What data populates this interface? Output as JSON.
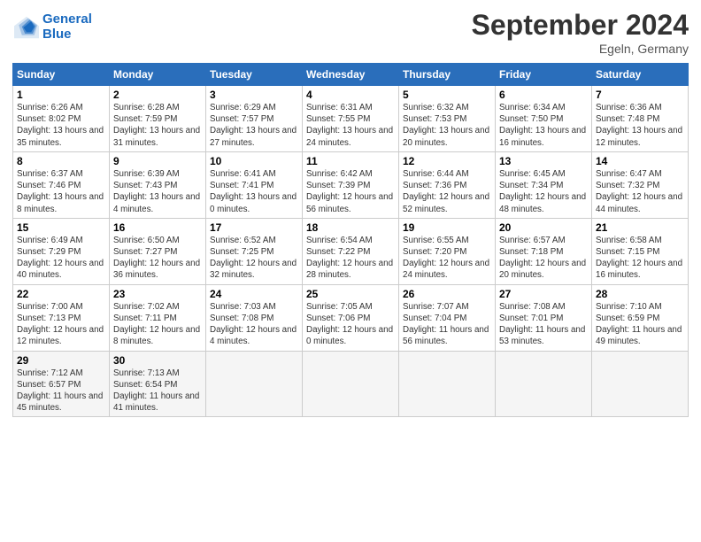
{
  "header": {
    "logo_line1": "General",
    "logo_line2": "Blue",
    "month_title": "September 2024",
    "location": "Egeln, Germany"
  },
  "days_of_week": [
    "Sunday",
    "Monday",
    "Tuesday",
    "Wednesday",
    "Thursday",
    "Friday",
    "Saturday"
  ],
  "weeks": [
    [
      {
        "day": "1",
        "sunrise": "6:26 AM",
        "sunset": "8:02 PM",
        "daylight": "13 hours and 35 minutes."
      },
      {
        "day": "2",
        "sunrise": "6:28 AM",
        "sunset": "7:59 PM",
        "daylight": "13 hours and 31 minutes."
      },
      {
        "day": "3",
        "sunrise": "6:29 AM",
        "sunset": "7:57 PM",
        "daylight": "13 hours and 27 minutes."
      },
      {
        "day": "4",
        "sunrise": "6:31 AM",
        "sunset": "7:55 PM",
        "daylight": "13 hours and 24 minutes."
      },
      {
        "day": "5",
        "sunrise": "6:32 AM",
        "sunset": "7:53 PM",
        "daylight": "13 hours and 20 minutes."
      },
      {
        "day": "6",
        "sunrise": "6:34 AM",
        "sunset": "7:50 PM",
        "daylight": "13 hours and 16 minutes."
      },
      {
        "day": "7",
        "sunrise": "6:36 AM",
        "sunset": "7:48 PM",
        "daylight": "13 hours and 12 minutes."
      }
    ],
    [
      {
        "day": "8",
        "sunrise": "6:37 AM",
        "sunset": "7:46 PM",
        "daylight": "13 hours and 8 minutes."
      },
      {
        "day": "9",
        "sunrise": "6:39 AM",
        "sunset": "7:43 PM",
        "daylight": "13 hours and 4 minutes."
      },
      {
        "day": "10",
        "sunrise": "6:41 AM",
        "sunset": "7:41 PM",
        "daylight": "13 hours and 0 minutes."
      },
      {
        "day": "11",
        "sunrise": "6:42 AM",
        "sunset": "7:39 PM",
        "daylight": "12 hours and 56 minutes."
      },
      {
        "day": "12",
        "sunrise": "6:44 AM",
        "sunset": "7:36 PM",
        "daylight": "12 hours and 52 minutes."
      },
      {
        "day": "13",
        "sunrise": "6:45 AM",
        "sunset": "7:34 PM",
        "daylight": "12 hours and 48 minutes."
      },
      {
        "day": "14",
        "sunrise": "6:47 AM",
        "sunset": "7:32 PM",
        "daylight": "12 hours and 44 minutes."
      }
    ],
    [
      {
        "day": "15",
        "sunrise": "6:49 AM",
        "sunset": "7:29 PM",
        "daylight": "12 hours and 40 minutes."
      },
      {
        "day": "16",
        "sunrise": "6:50 AM",
        "sunset": "7:27 PM",
        "daylight": "12 hours and 36 minutes."
      },
      {
        "day": "17",
        "sunrise": "6:52 AM",
        "sunset": "7:25 PM",
        "daylight": "12 hours and 32 minutes."
      },
      {
        "day": "18",
        "sunrise": "6:54 AM",
        "sunset": "7:22 PM",
        "daylight": "12 hours and 28 minutes."
      },
      {
        "day": "19",
        "sunrise": "6:55 AM",
        "sunset": "7:20 PM",
        "daylight": "12 hours and 24 minutes."
      },
      {
        "day": "20",
        "sunrise": "6:57 AM",
        "sunset": "7:18 PM",
        "daylight": "12 hours and 20 minutes."
      },
      {
        "day": "21",
        "sunrise": "6:58 AM",
        "sunset": "7:15 PM",
        "daylight": "12 hours and 16 minutes."
      }
    ],
    [
      {
        "day": "22",
        "sunrise": "7:00 AM",
        "sunset": "7:13 PM",
        "daylight": "12 hours and 12 minutes."
      },
      {
        "day": "23",
        "sunrise": "7:02 AM",
        "sunset": "7:11 PM",
        "daylight": "12 hours and 8 minutes."
      },
      {
        "day": "24",
        "sunrise": "7:03 AM",
        "sunset": "7:08 PM",
        "daylight": "12 hours and 4 minutes."
      },
      {
        "day": "25",
        "sunrise": "7:05 AM",
        "sunset": "7:06 PM",
        "daylight": "12 hours and 0 minutes."
      },
      {
        "day": "26",
        "sunrise": "7:07 AM",
        "sunset": "7:04 PM",
        "daylight": "11 hours and 56 minutes."
      },
      {
        "day": "27",
        "sunrise": "7:08 AM",
        "sunset": "7:01 PM",
        "daylight": "11 hours and 53 minutes."
      },
      {
        "day": "28",
        "sunrise": "7:10 AM",
        "sunset": "6:59 PM",
        "daylight": "11 hours and 49 minutes."
      }
    ],
    [
      {
        "day": "29",
        "sunrise": "7:12 AM",
        "sunset": "6:57 PM",
        "daylight": "11 hours and 45 minutes."
      },
      {
        "day": "30",
        "sunrise": "7:13 AM",
        "sunset": "6:54 PM",
        "daylight": "11 hours and 41 minutes."
      },
      null,
      null,
      null,
      null,
      null
    ]
  ],
  "labels": {
    "sunrise": "Sunrise:",
    "sunset": "Sunset:",
    "daylight": "Daylight:"
  }
}
